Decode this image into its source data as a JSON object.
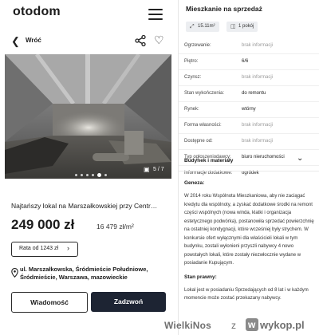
{
  "header": {
    "logo_text": "otodom"
  },
  "nav": {
    "back_label": "Wróć"
  },
  "gallery": {
    "counter": "5 / 7",
    "dots": 6,
    "active_dot": 4
  },
  "listing": {
    "title": "Najtańszy lokal na Marszałkowskiej przy Centr…",
    "price": "249 000 zł",
    "price_per_m2": "16 479 zł/m²",
    "installment_label": "Rata od 1243 zł",
    "address": "ul. Marszałkowska, Śródmieście Południowe, Śródmieście, Warszawa, mazowieckie"
  },
  "actions": {
    "message_label": "Wiadomość",
    "call_label": "Zadzwoń"
  },
  "details": {
    "title": "Mieszkanie na sprzedaż",
    "area_chip": "15.11m²",
    "rooms_chip": "1 pokój",
    "rows": [
      {
        "key": "Ogrzewanie:",
        "value": "brak informacji",
        "na": true
      },
      {
        "key": "Piętro:",
        "value": "6/6",
        "na": false
      },
      {
        "key": "Czynsz:",
        "value": "brak informacji",
        "na": true
      },
      {
        "key": "Stan wykończenia:",
        "value": "do remontu",
        "na": false
      },
      {
        "key": "Rynek:",
        "value": "wtórny",
        "na": false
      },
      {
        "key": "Forma własności:",
        "value": "brak informacji",
        "na": true
      },
      {
        "key": "Dostępne od:",
        "value": "brak informacji",
        "na": true
      },
      {
        "key": "Typ ogłoszeniodawcy:",
        "value": "biuro nieruchomości",
        "na": false
      },
      {
        "key": "Informacje dodatkowe:",
        "value": "ogródek",
        "na": false
      }
    ],
    "building_section": "Budynek i materiały",
    "description": {
      "geneza_heading": "Geneza:",
      "geneza_text": "W 2014 roku Wspólnota Mieszkaniowa, aby nie zaciągać kredytu dla wspólnoty, a zyskać dodatkowe środki na remont części wspólnych (nowa winda, klatki i organizacja estetycznego podwórka), postanowiła sprzedać powierzchnię na ostatniej kondygnacji, które wcześniej były strychem. W konkursie ofert wyłącznymi dla właścicieli lokali w tym budynku, zostali wyłonieni przyszli nabywcy 4 nowo powstałych lokali, które zostały niezwłocznie wydane w posiadanie Kupującym.",
      "stan_heading": "Stan prawny:",
      "stan_text": "Lokal jest w posiadaniu Sprzedających od 8 lat i w każdym momencie może zostać przekazany nabywcy."
    }
  },
  "watermark": {
    "text": "WielkiNos",
    "connector": "z",
    "site": "wykop.pl",
    "logo_letter": "w"
  },
  "colors": {
    "call_button_bg": "#1d2433",
    "chip_bg": "#eceef1",
    "na_text": "#9a9a9a"
  }
}
